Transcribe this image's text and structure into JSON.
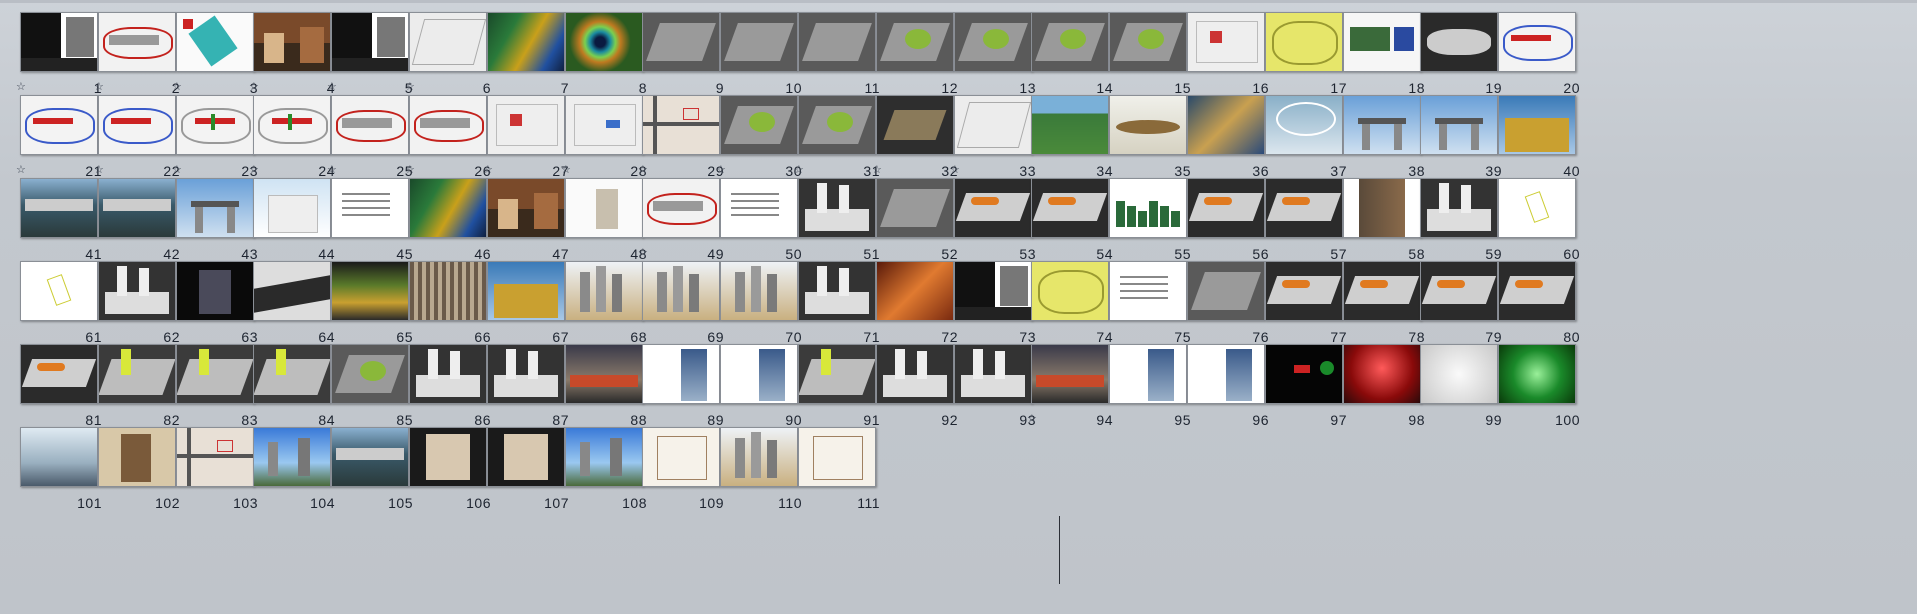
{
  "view": "slide-sorter",
  "slides": [
    {
      "n": "1",
      "style": "chinese-bw",
      "anim": true
    },
    {
      "n": "2",
      "style": "red-plan",
      "anim": true
    },
    {
      "n": "3",
      "style": "teal-plan",
      "anim": true
    },
    {
      "n": "4",
      "style": "chinese-photo",
      "anim": true
    },
    {
      "n": "5",
      "style": "chinese-bw",
      "anim": true
    },
    {
      "n": "6",
      "style": "sketch",
      "anim": true
    },
    {
      "n": "7",
      "style": "feathers",
      "anim": false
    },
    {
      "n": "8",
      "style": "peacock",
      "anim": false
    },
    {
      "n": "9",
      "style": "grey-model",
      "anim": false
    },
    {
      "n": "10",
      "style": "grey-model",
      "anim": false
    },
    {
      "n": "11",
      "style": "grey-model",
      "anim": false
    },
    {
      "n": "12",
      "style": "green-model",
      "anim": false
    },
    {
      "n": "13",
      "style": "green-model",
      "anim": false
    },
    {
      "n": "14",
      "style": "green-model",
      "anim": false
    },
    {
      "n": "15",
      "style": "green-model",
      "anim": false
    },
    {
      "n": "16",
      "style": "sketch-red",
      "anim": false
    },
    {
      "n": "17",
      "style": "yellow-plan",
      "anim": false
    },
    {
      "n": "18",
      "style": "blue-board",
      "anim": false
    },
    {
      "n": "19",
      "style": "dark-board",
      "anim": false
    },
    {
      "n": "20",
      "style": "blue-red-plan",
      "anim": false
    },
    {
      "n": "21",
      "style": "blue-red-plan",
      "anim": true
    },
    {
      "n": "22",
      "style": "blue-red-plan",
      "anim": true
    },
    {
      "n": "23",
      "style": "red-green-plan",
      "anim": true
    },
    {
      "n": "24",
      "style": "red-green-plan",
      "anim": true
    },
    {
      "n": "25",
      "style": "red-plan",
      "anim": true
    },
    {
      "n": "26",
      "style": "red-plan",
      "anim": true
    },
    {
      "n": "27",
      "style": "sketch-red",
      "anim": true
    },
    {
      "n": "28",
      "style": "sketch-blue",
      "anim": true
    },
    {
      "n": "29",
      "style": "map",
      "anim": true
    },
    {
      "n": "30",
      "style": "green-model",
      "anim": true
    },
    {
      "n": "31",
      "style": "green-model",
      "anim": true
    },
    {
      "n": "32",
      "style": "dark-model",
      "anim": true
    },
    {
      "n": "33",
      "style": "sketch",
      "anim": true
    },
    {
      "n": "34",
      "style": "green-photo",
      "anim": false
    },
    {
      "n": "35",
      "style": "render-light",
      "anim": false
    },
    {
      "n": "36",
      "style": "gold-render",
      "anim": false
    },
    {
      "n": "37",
      "style": "blue-render",
      "anim": false
    },
    {
      "n": "38",
      "style": "sky-building",
      "anim": false
    },
    {
      "n": "39",
      "style": "sky-building",
      "anim": false
    },
    {
      "n": "40",
      "style": "gold-building",
      "anim": false
    },
    {
      "n": "41",
      "style": "city-photo",
      "anim": false
    },
    {
      "n": "42",
      "style": "city-photo",
      "anim": false
    },
    {
      "n": "43",
      "style": "sky-building",
      "anim": false
    },
    {
      "n": "44",
      "style": "white-building",
      "anim": false
    },
    {
      "n": "45",
      "style": "text-slide",
      "anim": false
    },
    {
      "n": "46",
      "style": "feathers",
      "anim": false
    },
    {
      "n": "47",
      "style": "chinese-photo",
      "anim": false
    },
    {
      "n": "48",
      "style": "white-model",
      "anim": false
    },
    {
      "n": "49",
      "style": "red-plan",
      "anim": true
    },
    {
      "n": "50",
      "style": "text-slide",
      "anim": false
    },
    {
      "n": "51",
      "style": "white-towers",
      "anim": false
    },
    {
      "n": "52",
      "style": "grey-model",
      "anim": false
    },
    {
      "n": "53",
      "style": "orange-model",
      "anim": false
    },
    {
      "n": "54",
      "style": "orange-model",
      "anim": false
    },
    {
      "n": "55",
      "style": "green-chart",
      "anim": false
    },
    {
      "n": "56",
      "style": "orange-model",
      "anim": false
    },
    {
      "n": "57",
      "style": "orange-model",
      "anim": false
    },
    {
      "n": "58",
      "style": "street-photo",
      "anim": false
    },
    {
      "n": "59",
      "style": "white-towers",
      "anim": false
    },
    {
      "n": "60",
      "style": "diagram-small",
      "anim": false
    },
    {
      "n": "61",
      "style": "diagram-small",
      "anim": false
    },
    {
      "n": "62",
      "style": "white-towers",
      "anim": false
    },
    {
      "n": "63",
      "style": "night-building",
      "anim": false
    },
    {
      "n": "64",
      "style": "grey-building",
      "anim": false
    },
    {
      "n": "65",
      "style": "green-render",
      "anim": false
    },
    {
      "n": "66",
      "style": "glass-building",
      "anim": false
    },
    {
      "n": "67",
      "style": "gold-building",
      "anim": false
    },
    {
      "n": "68",
      "style": "towers-render",
      "anim": false
    },
    {
      "n": "69",
      "style": "towers-render",
      "anim": false
    },
    {
      "n": "70",
      "style": "towers-render",
      "anim": false
    },
    {
      "n": "71",
      "style": "white-towers",
      "anim": false
    },
    {
      "n": "72",
      "style": "canyon",
      "anim": false
    },
    {
      "n": "73",
      "style": "chinese-bw",
      "anim": false
    },
    {
      "n": "74",
      "style": "yellow-plan",
      "anim": false
    },
    {
      "n": "75",
      "style": "text-slide",
      "anim": false
    },
    {
      "n": "76",
      "style": "grey-model",
      "anim": false
    },
    {
      "n": "77",
      "style": "orange-model",
      "anim": false
    },
    {
      "n": "78",
      "style": "orange-model",
      "anim": false
    },
    {
      "n": "79",
      "style": "orange-model",
      "anim": false
    },
    {
      "n": "80",
      "style": "orange-model",
      "anim": false
    },
    {
      "n": "81",
      "style": "orange-model",
      "anim": false
    },
    {
      "n": "82",
      "style": "yellow-model",
      "anim": false
    },
    {
      "n": "83",
      "style": "yellow-model",
      "anim": false
    },
    {
      "n": "84",
      "style": "yellow-model",
      "anim": false
    },
    {
      "n": "85",
      "style": "green-model",
      "anim": false
    },
    {
      "n": "86",
      "style": "white-towers",
      "anim": false
    },
    {
      "n": "87",
      "style": "white-towers",
      "anim": false
    },
    {
      "n": "88",
      "style": "night-render",
      "anim": false
    },
    {
      "n": "89",
      "style": "tall-tower",
      "anim": false
    },
    {
      "n": "90",
      "style": "tall-tower",
      "anim": false
    },
    {
      "n": "91",
      "style": "yellow-model",
      "anim": false
    },
    {
      "n": "92",
      "style": "white-towers",
      "anim": false
    },
    {
      "n": "93",
      "style": "white-towers",
      "anim": false
    },
    {
      "n": "94",
      "style": "night-render",
      "anim": true
    },
    {
      "n": "95",
      "style": "tall-tower",
      "anim": false
    },
    {
      "n": "96",
      "style": "tall-tower",
      "anim": false
    },
    {
      "n": "97",
      "style": "black-slide",
      "anim": false
    },
    {
      "n": "98",
      "style": "red-glow",
      "anim": false
    },
    {
      "n": "99",
      "style": "white-cloud",
      "anim": false
    },
    {
      "n": "100",
      "style": "green-glow",
      "anim": false
    },
    {
      "n": "101",
      "style": "crowd-photo",
      "anim": false
    },
    {
      "n": "102",
      "style": "pagoda",
      "anim": false
    },
    {
      "n": "103",
      "style": "map",
      "anim": false
    },
    {
      "n": "104",
      "style": "towers-photo",
      "anim": false
    },
    {
      "n": "105",
      "style": "city-photo",
      "anim": false
    },
    {
      "n": "106",
      "style": "floorplan-dark",
      "anim": false
    },
    {
      "n": "107",
      "style": "floorplan-dark",
      "anim": false
    },
    {
      "n": "108",
      "style": "towers-photo",
      "anim": false
    },
    {
      "n": "109",
      "style": "floorplan",
      "anim": false
    },
    {
      "n": "110",
      "style": "towers-render",
      "anim": false
    },
    {
      "n": "111",
      "style": "floorplan",
      "anim": false
    }
  ],
  "icons": {
    "animation": "star-icon"
  },
  "colors": {
    "background": "#c3c8ce",
    "number": "#1d2430"
  }
}
